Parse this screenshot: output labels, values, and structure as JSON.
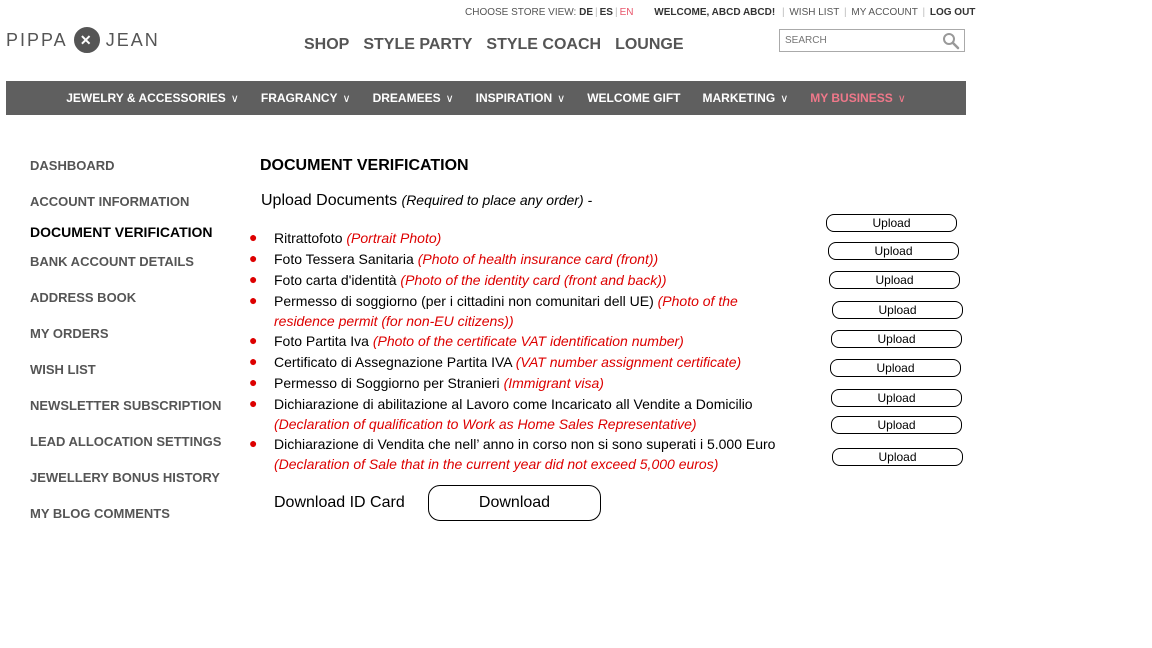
{
  "topbar": {
    "store_view_label": "CHOOSE STORE VIEW:",
    "lang_de": "DE",
    "lang_es": "ES",
    "lang_en": "EN",
    "welcome": "WELCOME, ABCD ABCD!",
    "wish_list": "WISH LIST",
    "my_account": "MY ACCOUNT",
    "logout": "LOG OUT"
  },
  "logo": {
    "left": "PIPPA",
    "right": "JEAN"
  },
  "mainnav": [
    "SHOP",
    "STYLE PARTY",
    "STYLE COACH",
    "LOUNGE"
  ],
  "search": {
    "placeholder": "SEARCH"
  },
  "catnav": [
    {
      "label": "JEWELRY & ACCESSORIES",
      "chevron": true
    },
    {
      "label": "FRAGRANCY",
      "chevron": true
    },
    {
      "label": "DREAMEES",
      "chevron": true
    },
    {
      "label": "INSPIRATION",
      "chevron": true
    },
    {
      "label": "WELCOME GIFT",
      "chevron": false
    },
    {
      "label": "MARKETING",
      "chevron": true
    },
    {
      "label": "MY BUSINESS",
      "chevron": true,
      "active": true
    }
  ],
  "sidebar": [
    "DASHBOARD",
    "ACCOUNT INFORMATION",
    "DOCUMENT VERIFICATION",
    "BANK ACCOUNT DETAILS",
    "ADDRESS BOOK",
    "MY ORDERS",
    "WISH LIST",
    "NEWSLETTER SUBSCRIPTION",
    "LEAD ALLOCATION SETTINGS",
    "JEWELLERY BONUS HISTORY",
    "MY BLOG COMMENTS"
  ],
  "sidebar_active": "DOCUMENT VERIFICATION",
  "page": {
    "title": "DOCUMENT VERIFICATION",
    "upload_heading": "Upload Documents",
    "upload_note": "(Required to place any order) -",
    "documents": [
      {
        "text": "Ritrattofoto",
        "translation": "(Portrait Photo)"
      },
      {
        "text": "Foto Tessera Sanitaria",
        "translation": "(Photo of health insurance card (front))"
      },
      {
        "text": "Foto carta d'identità",
        "translation": "(Photo of the identity card (front and back))"
      },
      {
        "text": "Permesso di soggiorno (per i cittadini non comunitari dell UE)",
        "translation": "(Photo of the residence permit (for non-EU citizens))"
      },
      {
        "text": "Foto Partita Iva",
        "translation": "(Photo of the certificate VAT identification number)"
      },
      {
        "text": "Certificato di Assegnazione Partita IVA",
        "translation": "(VAT number assignment certificate)"
      },
      {
        "text": "Permesso di Soggiorno per Stranieri",
        "translation": "(Immigrant visa)"
      },
      {
        "text": "Dichiarazione di abilitazione al Lavoro come Incaricato all Vendite a Domicilio",
        "translation": "(Declaration of qualification to Work as Home Sales Representative)"
      },
      {
        "text": "Dichiarazione di Vendita che nell’ anno in corso non si sono superati i 5.000 Euro",
        "translation": "(Declaration of Sale that in the current year did not exceed 5,000 euros)"
      }
    ],
    "upload_label": "Upload",
    "download_label": "Download ID Card",
    "download_button": "Download"
  }
}
